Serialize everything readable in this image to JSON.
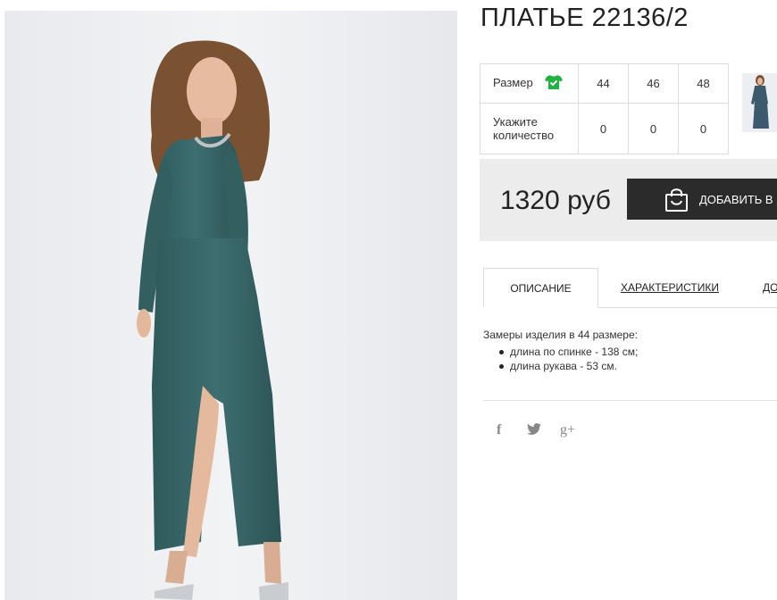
{
  "product": {
    "title": "ПЛАТЬЕ 22136/2",
    "photo_icon": "dress-model-photo",
    "thumbnail_icon": "dress-thumbnail"
  },
  "sizes": {
    "size_label": "Размер",
    "size_icon": "shirt-check-icon",
    "size_icon_color": "#1fb141",
    "quantity_label_line1": "Укажите",
    "quantity_label_line2": "количество",
    "options": [
      {
        "size": "44",
        "qty": "0"
      },
      {
        "size": "46",
        "qty": "0"
      },
      {
        "size": "48",
        "qty": "0"
      }
    ]
  },
  "purchase": {
    "price": "1320 руб",
    "add_to_cart_label": "ДОБАВИТЬ В З",
    "cart_icon": "shopping-bag-icon",
    "button_color": "#2b2b2b"
  },
  "tabs": [
    {
      "label": "ОПИСАНИЕ",
      "active": true
    },
    {
      "label": "ХАРАКТЕРИСТИКИ",
      "active": false
    },
    {
      "label": "ДО",
      "active": false
    }
  ],
  "description": {
    "intro": "Замеры изделия в 44 размере:",
    "items": [
      "длина по спинке - 138 см;",
      "длина рукава - 53 см."
    ]
  },
  "social": {
    "facebook": "f",
    "twitter_icon": "twitter-icon",
    "googleplus": "g+"
  }
}
